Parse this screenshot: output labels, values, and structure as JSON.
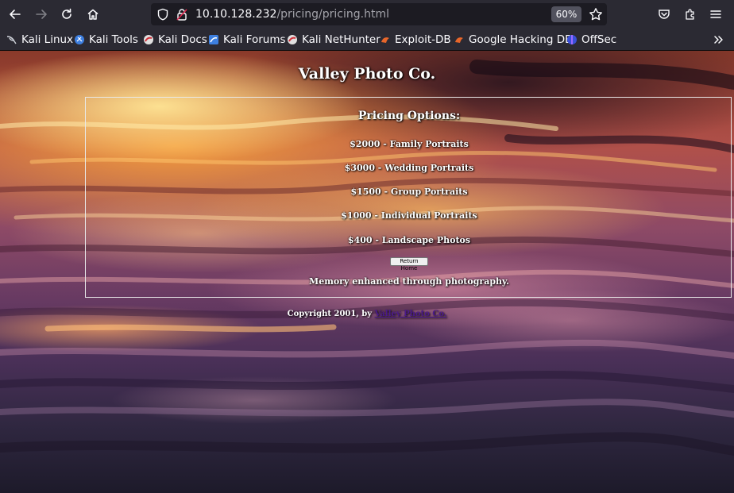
{
  "browser": {
    "url_host": "10.10.128.232",
    "url_path": "/pricing/pricing.html",
    "zoom": "60%"
  },
  "bookmarks": [
    {
      "label": "Kali Linux",
      "icon": "kali-dragon-icon"
    },
    {
      "label": "Kali Tools",
      "icon": "kali-tools-icon"
    },
    {
      "label": "Kali Docs",
      "icon": "kali-docs-icon"
    },
    {
      "label": "Kali Forums",
      "icon": "kali-forums-icon"
    },
    {
      "label": "Kali NetHunter",
      "icon": "kali-nethunter-icon"
    },
    {
      "label": "Exploit-DB",
      "icon": "exploit-db-icon"
    },
    {
      "label": "Google Hacking DB",
      "icon": "ghdb-icon"
    },
    {
      "label": "OffSec",
      "icon": "offsec-icon"
    }
  ],
  "page": {
    "site_title": "Valley Photo Co.",
    "pricing_heading": "Pricing Options:",
    "prices": [
      "$2000 - Family Portraits",
      "$3000 - Wedding Portraits",
      "$1500 - Group Portraits",
      "$1000 - Individual Portraits",
      "$400 - Landscape Photos"
    ],
    "return_button": "Return Home",
    "tagline": "Memory enhanced through photography.",
    "copyright_prefix": "Copyright 2001, by",
    "copyright_link": "Valley Photo Co."
  }
}
